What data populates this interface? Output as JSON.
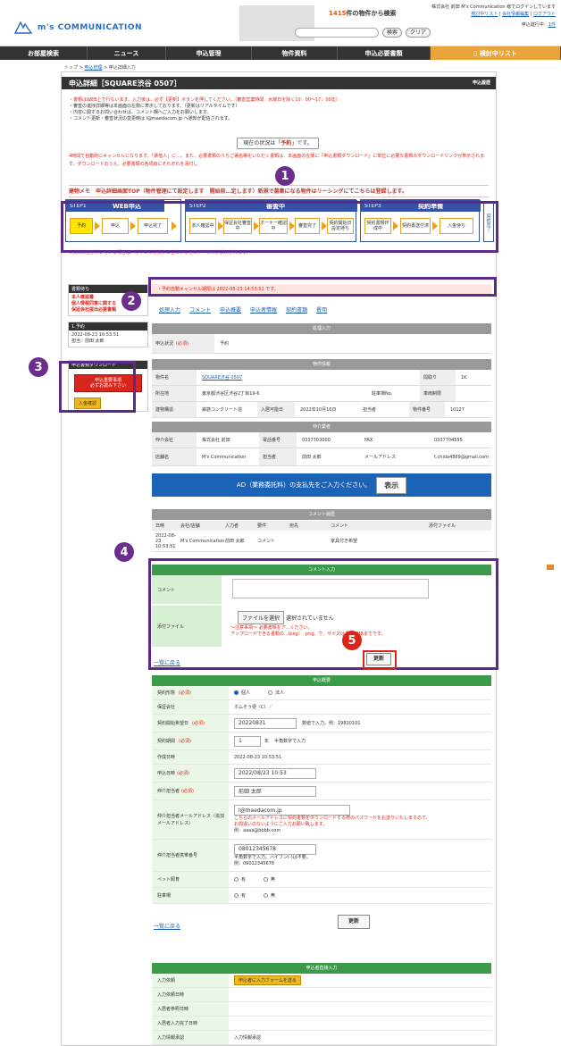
{
  "header": {
    "logo_text": "m's COMMUNICATION",
    "count_num": "1415",
    "count_text": "件の物件から検索",
    "search_label": "検索",
    "clear_label": "クリア",
    "company_line": "株式会社 前田 M's Communication 様でログインしています",
    "link1": "検討中リスト",
    "link2": "会社情報編集",
    "link3": "ログアウト",
    "cart_prefix": "申込進行中：",
    "cart_count": "1件"
  },
  "nav": {
    "items": [
      "お部屋検索",
      "ニュース",
      "申込管理",
      "物件資料",
      "申込必要書類",
      "検討中リスト"
    ]
  },
  "breadcrumb": {
    "home": "トップ",
    "sep": " > ",
    "link": "申込管理",
    "current": "申込詳細入力"
  },
  "page": {
    "title": "申込詳細［SQUARE渋谷 0507］",
    "right_link": "申込履歴"
  },
  "notes": {
    "line1": "・書類はWEB上で行ないます。入力後は、必ず【更新】ボタンを押してください。（審査営業時間　水曜日を除く10：00〜17：00迄）",
    "line2": "・審査の進捗詳細等は本画面の左側に表示しております。（更新はリアルタイムです）",
    "line3": "・内容に関するお問い合わせは、コメント欄へご入力をお願いします。",
    "line4": "・コメント更新・審査状況の変更時は l@maedacom.jp へ通知が配信されます。"
  },
  "status": {
    "prefix": "現在の状況は「",
    "value": "予約",
    "suffix": "」です。"
  },
  "long_notice": "4時間で自動的にキャンセルになります。「賃借人」に…。また、必要書類のうちご署名等をいただく書類は、本画面の左側に「申込書類ダウンロード」に単位に必要な書類のダウンロードリンクが表示されます。ダウンロードのうえ、必要書類の各項目にそれぞれを添付し",
  "memo": "建物メモ　申込詳細画面TOP（物件管理にて設定します　開始前…定します）新規で募集になる物件はリーシングにてこちらは登録します。",
  "steps": {
    "step1_label": "STEP1",
    "step1_name": "WEB申込",
    "step2_label": "STEP2",
    "step2_name": "審査中",
    "step3_label": "STEP3",
    "step3_name": "契約準備",
    "cells": [
      "予約",
      "申込",
      "申込完了",
      "本人確認中",
      "保証会社審査中",
      "オーナー確認中",
      "審査完了",
      "契約開始日設定待ち",
      "契約書類作成中",
      "契約書送付済",
      "入金待ち"
    ],
    "final": "契約完了",
    "red_note": "※矢印に色が付いている場合は、ポインタを矢印に合わせるとステータスが表示されます。"
  },
  "sidebar": {
    "docs_head": "書類待ち",
    "docs_line1": "本人確認書",
    "docs_line2": "個人情報同意に関する",
    "docs_line3": "保証会社提出必要書類",
    "hist_head": "1.予約",
    "hist_date": "2022-08-23 10:53:51",
    "hist_by": "担当：前田 太郎",
    "download_head": "申込書類ダウンロード",
    "red_btn_line1": "申込重要事項",
    "red_btn_line2": "必ずお読み下さい",
    "yellow_btn": "入金確認"
  },
  "alert": "・予約自動キャンセル期限は 2022-08-23 14:53:51 です。",
  "tabs": [
    "処理入力",
    "コメント",
    "申込概要",
    "申込者情報",
    "契約書類",
    "費用"
  ],
  "processing": {
    "head": "処理入力",
    "label": "申込状況",
    "required": "(必須)",
    "value": "予約"
  },
  "property": {
    "head": "物件情報",
    "name_label": "物件名",
    "name_value": "SQUARE渋谷 0507",
    "layout_label": "間取り",
    "layout_value": "1K",
    "addr_label": "所在地",
    "addr_value": "東京都渋谷区渋谷2丁目19-6",
    "parking_label": "駐車場No.",
    "car_label": "車両制限",
    "struct_label": "建物構造",
    "struct_value": "鉄筋コンクリート造",
    "movein_label": "入居可能日",
    "movein_value": "2022年10月16日",
    "staff_label": "担当者",
    "propno_label": "物件番号",
    "propno_value": "10127"
  },
  "broker": {
    "head": "仲介業者",
    "company_label": "仲介会社",
    "company_value": "株式会社 前田",
    "tel_label": "電話番号",
    "tel_value": "0337703000",
    "fax_label": "FAX",
    "fax_value": "0337704555",
    "shop_label": "店舗名",
    "shop_value": "M's Communication",
    "person_label": "担当者",
    "person_value": "前田 太郎",
    "mail_label": "メールアドレス",
    "mail_value": "t.chida4869@gmail.com"
  },
  "ad": {
    "text": "AD（業務委託料）の支払先をご入力ください。",
    "button": "表示"
  },
  "comment_history": {
    "head": "コメント履歴",
    "cols": [
      "日時",
      "会社/店舗",
      "入力者",
      "要件",
      "宛先",
      "コメント",
      "添付ファイル"
    ],
    "row": [
      "2022-08-23 10:53:51",
      "M's Communication",
      "前田 太郎",
      "コメント",
      "",
      "家具付き希望",
      ""
    ]
  },
  "comment_input": {
    "head": "コメント入力",
    "comment_label": "コメント",
    "file_label": "添付ファイル",
    "file_button": "ファイルを選択",
    "file_status": "選択されていません",
    "warn1": "〜注意事項〜 必要書類をア…ください。",
    "warn2": "アップロードできる書類の…lpeg）. png、で、サイズは最大5MBまでです。",
    "back_link": "一覧に戻る",
    "update_button": "更新"
  },
  "summary": {
    "head": "申込概要",
    "contract_type_label": "契約形態",
    "req": "(必須)",
    "opt_personal": "個人",
    "opt_corp": "法人",
    "guarantor_label": "保証会社",
    "guarantor_value": "ホムそう便（C）／",
    "start_label": "契約開始希望日",
    "start_value": "20220831",
    "start_hint": "数値で入力。例：19810101",
    "period_label": "契約期間",
    "period_value": "1",
    "period_unit": "年",
    "period_hint": "半角数字で入力",
    "created_label": "作成日時",
    "created_value": "2022-08-23 10:53:51",
    "applied_label": "申込日時",
    "applied_value": "2022/08/23 10:53",
    "agent_label": "仲介担当者",
    "agent_value": "前田 太郎",
    "agent_mail_label": "仲介担当者メールアドレス（追加メールアドレス）",
    "agent_mail_value": "l@maedacom.jp",
    "agent_mail_note1": "こちらのメールアドレスに契約書類をダウンロードする際のパスワードをお送りいたしますので、",
    "agent_mail_note2": "お間違いのないようにご入力お願い致します。",
    "agent_mail_example": "例：aaaa@bbbb.com",
    "agent_tel_label": "仲介担当者携帯番号",
    "agent_tel_value": "08012345678",
    "agent_tel_hint": "半角数字で入力。ハイフン(-)は不要。",
    "agent_tel_example": "例：09012345678",
    "pet_label": "ペット飼育",
    "opt_yes": "有",
    "opt_no": "無",
    "parking_label": "駐車場",
    "back_link": "一覧に戻る",
    "update_button": "更新"
  },
  "direct": {
    "head": "申込者直接入力",
    "req_label": "入力依頼",
    "req_button": "申込者に入力フォームを送る",
    "ref_label": "入力依頼日時",
    "view_label": "入居者参照日時",
    "done_label": "入居者入力完了日時",
    "approve_label": "入力情報承認",
    "approve_value": "入力情報承認"
  },
  "markers": [
    "1",
    "2",
    "3",
    "4",
    "5"
  ],
  "colors": {
    "purple": "#5d2a8c",
    "red": "#d9261c",
    "green": "#3a9a4a",
    "navy": "#3552a6",
    "blue_band": "#1b63b7"
  }
}
